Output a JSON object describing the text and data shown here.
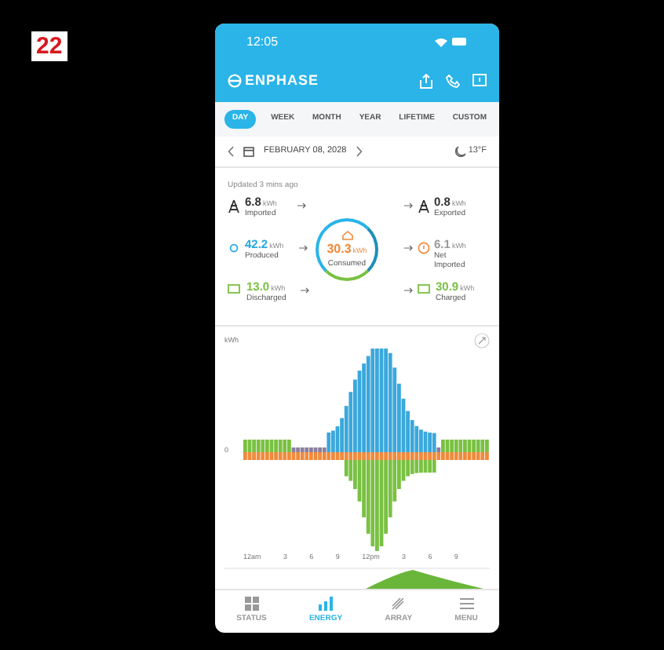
{
  "figure_label": "22",
  "status_bar": {
    "time": "12:05"
  },
  "header": {
    "brand": "ENPHASE"
  },
  "tabs": [
    {
      "label": "DAY",
      "selected": true
    },
    {
      "label": "WEEK",
      "selected": false
    },
    {
      "label": "MONTH",
      "selected": false
    },
    {
      "label": "YEAR",
      "selected": false
    },
    {
      "label": "LIFETIME",
      "selected": false
    },
    {
      "label": "CUSTOM",
      "selected": false
    }
  ],
  "date_bar": {
    "date": "FEBRUARY 08, 2028",
    "weather": "13°F"
  },
  "updated": "Updated 3 mins ago",
  "flows": [
    {
      "kind": "grid",
      "value": "6.8",
      "unit": "kWh",
      "label": "Imported",
      "color": "#333333"
    },
    {
      "kind": "grid",
      "value": "0.8",
      "unit": "kWh",
      "label": "Exported",
      "color": "#333333"
    },
    {
      "kind": "solar",
      "value": "42.2",
      "unit": "kWh",
      "label": "Produced",
      "color": "#29a8e0"
    },
    {
      "kind": "net",
      "value": "6.1",
      "unit": "kWh",
      "label": "Net Imported",
      "color": "#9a9a9a"
    },
    {
      "kind": "battery",
      "value": "13.0",
      "unit": "kWh",
      "label": "Discharged",
      "color": "#7ac143"
    },
    {
      "kind": "battery",
      "value": "30.9",
      "unit": "kWh",
      "label": "Charged",
      "color": "#7ac143"
    }
  ],
  "consumed": {
    "value": "30.3",
    "unit": "kWh",
    "label": "Consumed"
  },
  "chart": {
    "unit": "kWh",
    "zero": "0",
    "x_labels": [
      "12am",
      "3",
      "6",
      "9",
      "12pm",
      "3",
      "6",
      "9"
    ]
  },
  "nav": [
    {
      "label": "STATUS",
      "selected": false
    },
    {
      "label": "ENERGY",
      "selected": true
    },
    {
      "label": "ARRAY",
      "selected": false
    },
    {
      "label": "MENU",
      "selected": false
    }
  ]
}
